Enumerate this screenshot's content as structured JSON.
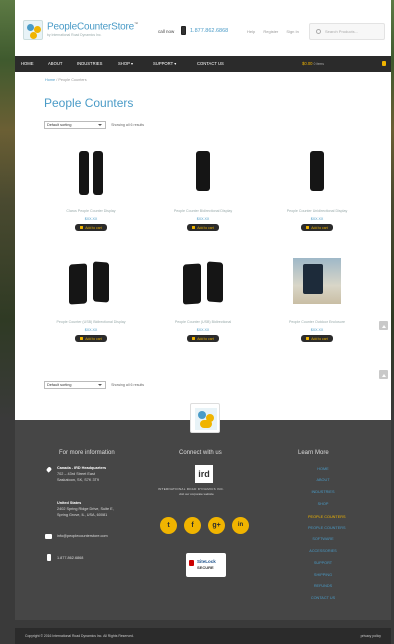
{
  "header": {
    "logo_name": "PeopleCounterStore",
    "logo_tm": "™",
    "logo_tagline": "by International Road Dynamics Inc.",
    "call_label": "call now",
    "phone": "1.877.862.6868",
    "links": [
      "Help",
      "Register",
      "Sign In"
    ],
    "search_placeholder": "Search Products..."
  },
  "nav": {
    "items": [
      "HOME",
      "ABOUT",
      "INDUSTRIES",
      "SHOP",
      "SUPPORT",
      "CONTACT US"
    ],
    "cart_total": "$0.00",
    "cart_items": "0 items"
  },
  "breadcrumb": {
    "home": "Home",
    "sep": " / ",
    "current": "People Counters"
  },
  "page_title": "People Counters",
  "sort": {
    "selected": "Default sorting",
    "showing": "Showing all 6 results"
  },
  "products": [
    {
      "name": "Clarus People Counter Display",
      "price": "$XX.XX",
      "button": "Add to cart"
    },
    {
      "name": "People Counter Bidirectional Display",
      "price": "$XX.XX",
      "button": "Add to cart"
    },
    {
      "name": "People Counter Unidirectional Display",
      "price": "$XX.XX",
      "button": "Add to cart"
    },
    {
      "name": "People Counter (USB) Bidirectional Display",
      "price": "$XX.XX",
      "button": "Add to cart"
    },
    {
      "name": "People Counter (USB) Bidirectional",
      "price": "$XX.XX",
      "button": "Add to cart"
    },
    {
      "name": "People Counter Outdoor Enclosure",
      "price": "$XX.XX",
      "button": "Add to cart"
    }
  ],
  "footer": {
    "info_heading": "For more information",
    "hq_title": "Canada - IRD Headquarters",
    "hq_lines": [
      "702 – 43rd Street East",
      "Saskatoon, SK, S7K 3T9"
    ],
    "us_title": "United States",
    "us_lines": [
      "2402 Spring Ridge Drive, Suite E,",
      "Spring Grove, IL, USA, 60081"
    ],
    "email": "info@peoplecounterstore.com",
    "phone": "1.877.862.6868",
    "connect_heading": "Connect with us",
    "ird_logo": "ird",
    "ird_name": "INTERNATIONAL ROAD DYNAMICS INC.",
    "ird_sub": "visit our corporate website",
    "social": [
      "t",
      "f",
      "g+",
      "in"
    ],
    "seal_top": "SiteLock",
    "seal_bottom": "SECURE",
    "learn_heading": "Learn More",
    "learn_links": [
      "HOME",
      "ABOUT",
      "INDUSTRIES",
      "SHOP",
      "PEOPLE COUNTERS",
      "PEOPLE COUNTERS",
      "SOFTWARE",
      "ACCESSORIES",
      "SUPPORT",
      "SHIPPING",
      "REFUNDS",
      "CONTACT US"
    ]
  },
  "bottom": {
    "copyright": "Copyright © 2016 International Road Dynamics Inc. All Rights Reserved.",
    "privacy": "privacy policy"
  },
  "colors": {
    "accent": "#4a9bc7",
    "gold": "#f0b400",
    "nav_bg": "#2b2b2b",
    "footer_bg": "#464646"
  }
}
